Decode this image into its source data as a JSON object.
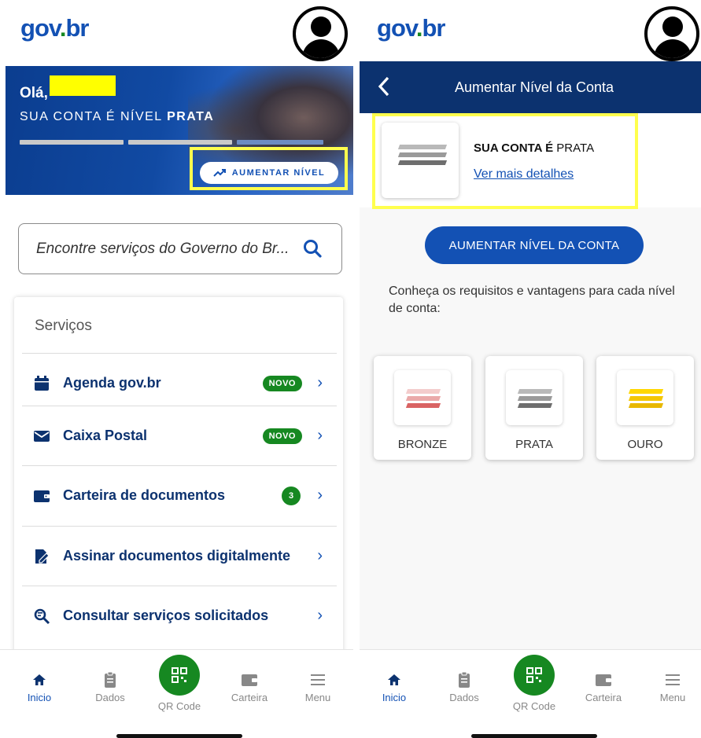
{
  "left": {
    "logo": "gov.br",
    "greeting": "Olá,",
    "level_prefix": "SUA CONTA É NÍVEL",
    "level_name": "PRATA",
    "raise_level_button": "AUMENTAR NÍVEL",
    "search_placeholder": "Encontre serviços do Governo do Br...",
    "services_title": "Serviços",
    "services": [
      {
        "label": "Agenda gov.br",
        "badge": "NOVO",
        "icon": "calendar-icon"
      },
      {
        "label": "Caixa Postal",
        "badge": "NOVO",
        "icon": "envelope-icon"
      },
      {
        "label": "Carteira de documentos",
        "badge": "3",
        "icon": "wallet-icon"
      },
      {
        "label": "Assinar documentos digitalmente",
        "badge": "",
        "icon": "signature-icon"
      },
      {
        "label": "Consultar serviços solicitados",
        "badge": "",
        "icon": "search-document-icon"
      }
    ]
  },
  "right": {
    "logo": "gov.br",
    "title": "Aumentar Nível da Conta",
    "account_prefix": "SUA CONTA É",
    "account_level": "PRATA",
    "details_link": "Ver mais detalhes",
    "raise_button": "AUMENTAR NÍVEL DA CONTA",
    "requirements_text": "Conheça os requisitos e vantagens para cada nível de conta:",
    "levels": [
      {
        "name": "BRONZE",
        "colors": [
          "#f1c3c3",
          "#e9a3a3",
          "#d96060"
        ]
      },
      {
        "name": "PRATA",
        "colors": [
          "#b9b9b9",
          "#9a9a9a",
          "#6e6e6e"
        ]
      },
      {
        "name": "OURO",
        "colors": [
          "#ffd700",
          "#f4c600",
          "#e8b800"
        ]
      }
    ]
  },
  "nav": {
    "items": [
      "Inicio",
      "Dados",
      "QR Code",
      "Carteira",
      "Menu"
    ],
    "active": "Inicio"
  },
  "colors": {
    "primary": "#1351b4",
    "dark_blue": "#0c326f",
    "green": "#168821",
    "highlight": "#ffff4d"
  }
}
